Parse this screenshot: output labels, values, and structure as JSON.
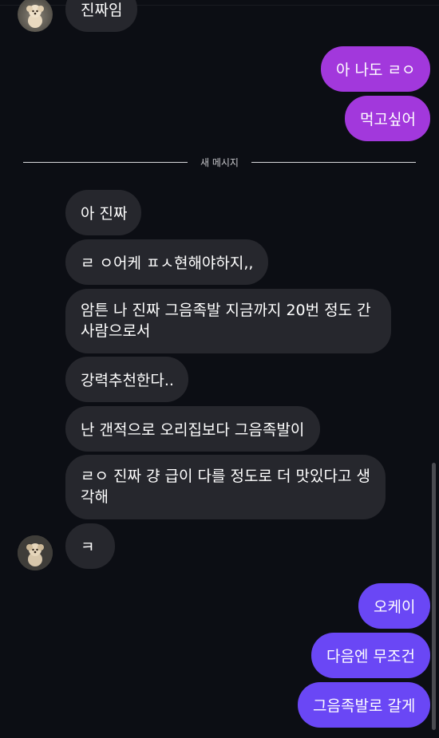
{
  "conversation": {
    "divider_label": "새 메시지",
    "messages": [
      {
        "text": "진짜임",
        "side": "incoming"
      },
      {
        "text": "아 나도 ㄹㅇ",
        "side": "outgoing"
      },
      {
        "text": "먹고싶어",
        "side": "outgoing"
      },
      {
        "text": "아 진짜",
        "side": "incoming"
      },
      {
        "text": "ㄹ ㅇ어케 ㅍㅅ현해야하지,,",
        "side": "incoming"
      },
      {
        "text": "암튼 나 진짜 그음족발 지금까지 20번 정도 간 사람으로서",
        "side": "incoming"
      },
      {
        "text": "강력추천한다..",
        "side": "incoming"
      },
      {
        "text": "난 갠적으로 오리집보다 그음족발이",
        "side": "incoming"
      },
      {
        "text": "ㄹㅇ 진짜 걍 급이 다를 정도로 더 맛있다고 생각해",
        "side": "incoming"
      },
      {
        "text": "ㅋ",
        "side": "incoming"
      },
      {
        "text": "오케이",
        "side": "outgoing"
      },
      {
        "text": "다음엔 무조건",
        "side": "outgoing"
      },
      {
        "text": "그음족발로 갈게",
        "side": "outgoing"
      }
    ]
  },
  "colors": {
    "background": "#0c0e14",
    "incoming_bubble": "#26272d",
    "outgoing_bubble_purple": "#a238dc",
    "outgoing_bubble_violet": "#6a47f5"
  },
  "icons": {
    "avatar": "dog-avatar-icon"
  }
}
